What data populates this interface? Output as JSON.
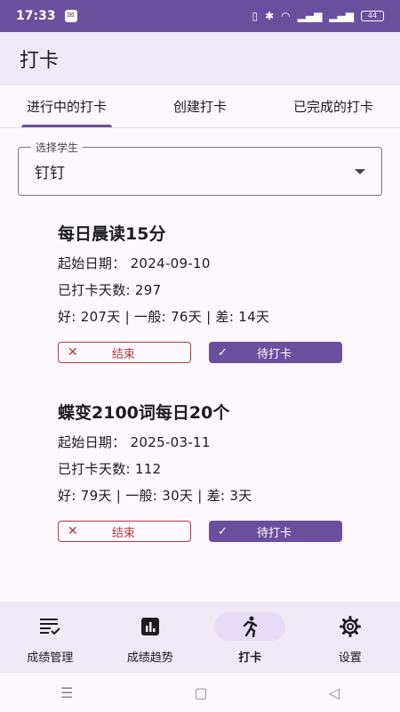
{
  "status_bar": {
    "time": "17:33",
    "battery": "44"
  },
  "app_bar": {
    "title": "打卡"
  },
  "tabs": [
    {
      "label": "进行中的打卡",
      "active": true
    },
    {
      "label": "创建打卡",
      "active": false
    },
    {
      "label": "已完成的打卡",
      "active": false
    }
  ],
  "student_select": {
    "legend": "选择学生",
    "value": "钉钉"
  },
  "checkins": [
    {
      "name": "每日晨读15分",
      "start_date": "起始日期：  2024-09-10",
      "days": "已打卡天数: 297",
      "ratings": "好: 207天 | 一般: 76天 | 差: 14天",
      "end_label": "结束",
      "pending_label": "待打卡"
    },
    {
      "name": "蝶变2100词每日20个",
      "start_date": "起始日期：  2025-03-11",
      "days": "已打卡天数: 112",
      "ratings": "好: 79天 | 一般: 30天 | 差: 3天",
      "end_label": "结束",
      "pending_label": "待打卡"
    }
  ],
  "bottom_nav": [
    {
      "label": "成绩管理",
      "icon": "list-check-icon",
      "active": false
    },
    {
      "label": "成绩趋势",
      "icon": "bar-chart-icon",
      "active": false
    },
    {
      "label": "打卡",
      "icon": "running-person-icon",
      "active": true
    },
    {
      "label": "设置",
      "icon": "gear-icon",
      "active": false
    }
  ],
  "colors": {
    "primary": "#6a4f9e",
    "danger": "#b33a3a",
    "surface": "#fdf7fe"
  }
}
